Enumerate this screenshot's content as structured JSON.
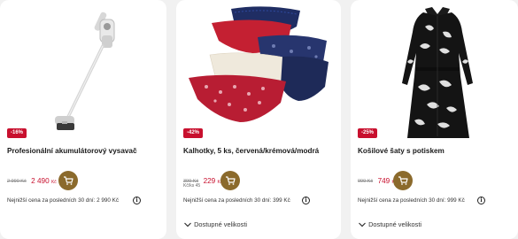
{
  "products": [
    {
      "badge": "-16%",
      "title": "Profesionální akumulátorový vysavač",
      "old_price": "2 990 Kč",
      "price": "2 490",
      "currency": "Kč",
      "lowest_price_note": "Nejnižší cena za posledních 30 dní: 2 990 Kč",
      "image_icon": "cordless-vacuum"
    },
    {
      "badge": "-42%",
      "title": "Kalhotky, 5 ks, červená/krémová/modrá",
      "old_price": "399 Kč",
      "price": "229",
      "currency": "Kč",
      "unit_price": "Kč/ks 45",
      "lowest_price_note": "Nejnižší cena za posledních 30 dní: 399 Kč",
      "sizes_label": "Dostupné velikosti",
      "image_icon": "panties-stack"
    },
    {
      "badge": "-25%",
      "title": "Košilové šaty s potiskem",
      "old_price": "999 Kč",
      "price": "749",
      "currency": "Kč",
      "lowest_price_note": "Nejnižší cena za posledních 30 dní: 999 Kč",
      "sizes_label": "Dostupné velikosti",
      "image_icon": "printed-shirt-dress"
    }
  ],
  "colors": {
    "accent": "#8b6a2c",
    "sale": "#c8102e",
    "background": "#f1f1f1"
  }
}
